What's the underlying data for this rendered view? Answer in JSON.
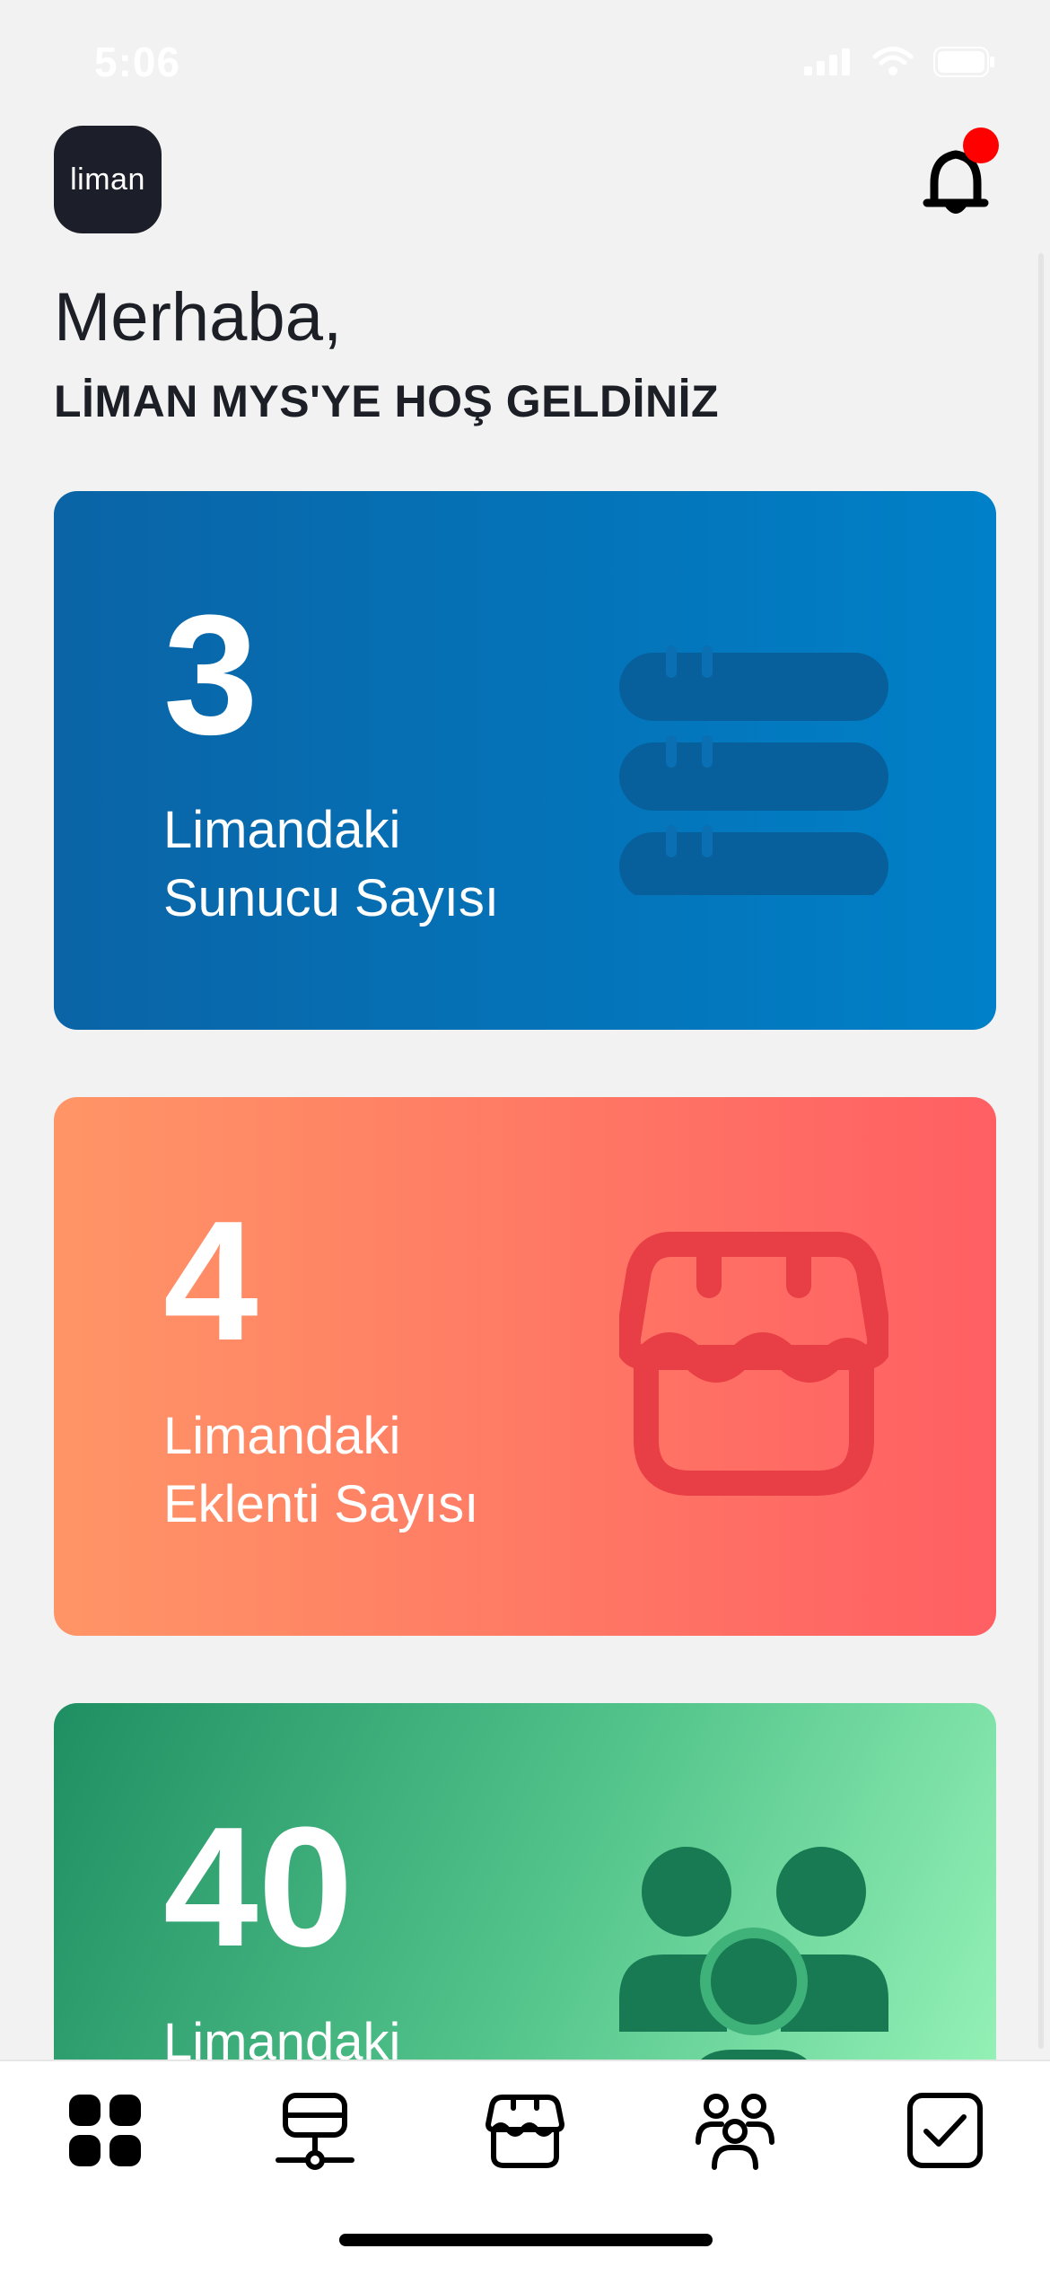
{
  "status_bar": {
    "time": "5:06"
  },
  "header": {
    "logo_text": "liman",
    "has_notification": true
  },
  "greeting": {
    "title": "Merhaba,",
    "subtitle": "LİMAN MYS'YE HOŞ GELDİNİZ"
  },
  "cards": [
    {
      "number": "3",
      "label_line1": "Limandaki",
      "label_line2": "Sunucu Sayısı",
      "icon": "server-icon",
      "color": "#0a6fb3"
    },
    {
      "number": "4",
      "label_line1": "Limandaki",
      "label_line2": "Eklenti Sayısı",
      "icon": "store-icon",
      "color": "#ff7a62"
    },
    {
      "number": "40",
      "label_line1": "Limandaki",
      "label_line2": "",
      "icon": "users-icon",
      "color": "#3fb27a"
    }
  ],
  "tab_bar": {
    "tabs": [
      {
        "name": "dashboard",
        "icon": "dashboard-icon",
        "active": true
      },
      {
        "name": "servers",
        "icon": "server-network-icon",
        "active": false
      },
      {
        "name": "extensions",
        "icon": "store-icon",
        "active": false
      },
      {
        "name": "users",
        "icon": "users-icon",
        "active": false
      },
      {
        "name": "tasks",
        "icon": "checkbox-icon",
        "active": false
      }
    ]
  }
}
